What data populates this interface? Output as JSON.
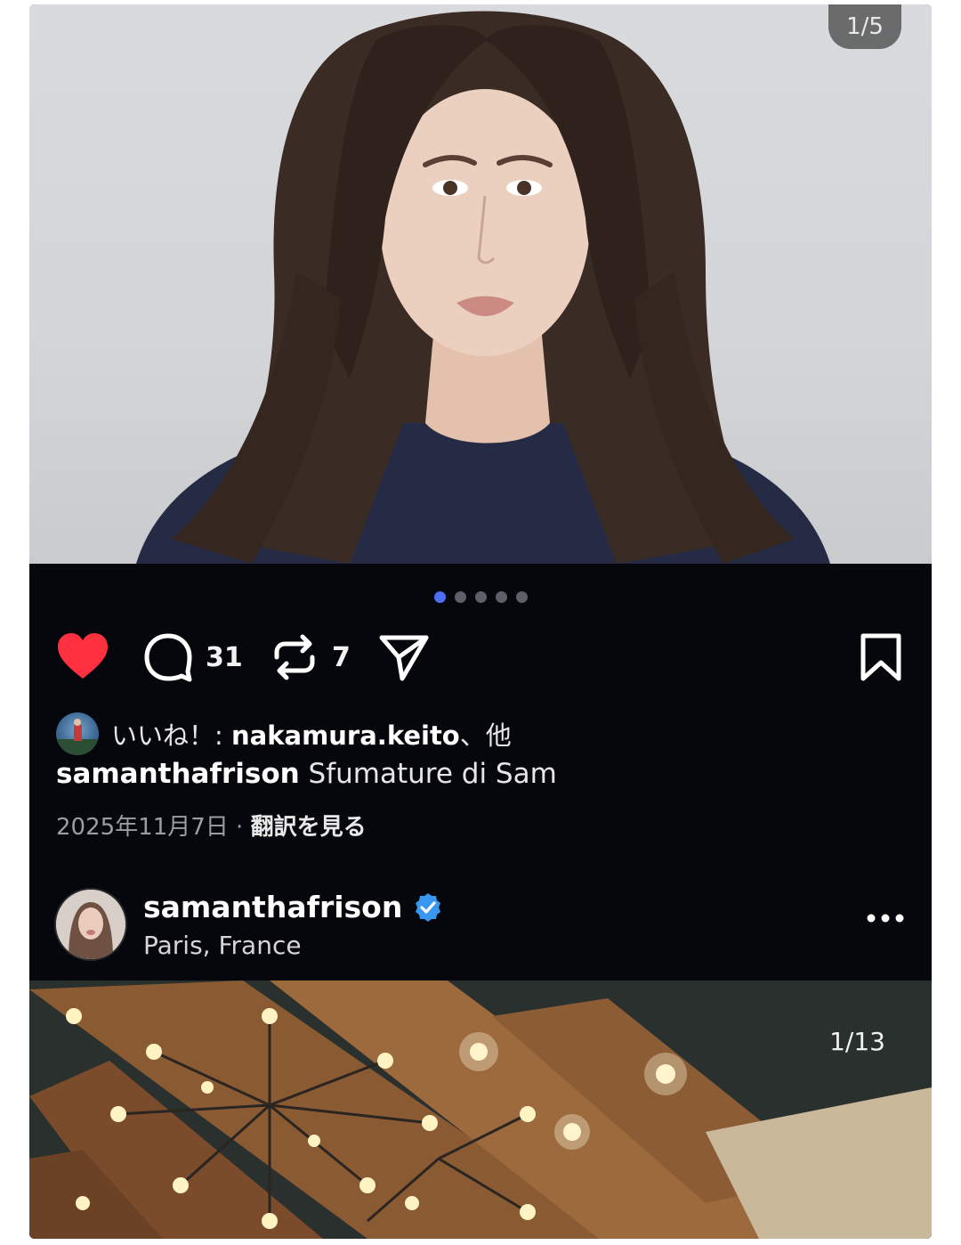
{
  "post1": {
    "image_counter": "1/5",
    "carousel": {
      "total": 5,
      "active_index": 0
    },
    "actions": {
      "comment_count": "31",
      "repost_count": "7"
    },
    "liked_prefix": "いいね！: ",
    "liked_by_user": "nakamura.keito",
    "liked_suffix": "、他",
    "caption_user": "samanthafrison",
    "caption_text": " Sfumature di Sam",
    "date": "2025年11月7日",
    "separator": " · ",
    "translate_label": "翻訳を見る"
  },
  "post2": {
    "username": "samanthafrison",
    "location": "Paris, France",
    "image_counter": "1/13"
  },
  "colors": {
    "background": "#06070d",
    "like_red": "#ff3040",
    "active_dot": "#4c6ef5",
    "verified_blue": "#3897f0"
  },
  "icons": [
    "heart-icon",
    "comment-icon",
    "repost-icon",
    "share-icon",
    "bookmark-icon",
    "verified-badge-icon",
    "more-icon"
  ]
}
